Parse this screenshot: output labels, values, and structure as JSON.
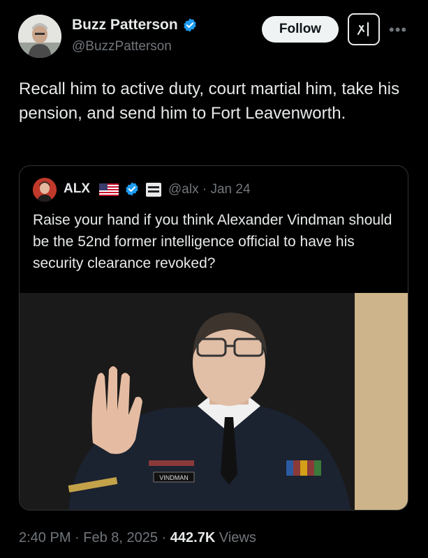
{
  "author": {
    "name": "Buzz Patterson",
    "handle": "@BuzzPatterson",
    "verified": true
  },
  "actions": {
    "follow_label": "Follow",
    "grok_icon": "grok-icon",
    "more_icon": "more-icon"
  },
  "tweet": {
    "text": "Recall him to active duty, court martial him, take his pension, and send him to Fort Leavenworth."
  },
  "quote": {
    "name": "ALX",
    "handle": "@alx",
    "date": "Jan 24",
    "meta": "@alx · Jan 24",
    "text": "Raise your hand if you think Alexander Vindman should be the 52nd former intelligence official to have his security clearance revoked?",
    "image_nameplate": "VINDMAN"
  },
  "footer": {
    "time": "2:40 PM",
    "date": "Feb 8, 2025",
    "views_count": "442.7K",
    "views_label": "Views"
  },
  "colors": {
    "background": "#000000",
    "text": "#e7e9ea",
    "muted": "#71767b",
    "verified": "#1d9bf0",
    "border": "#2f3336"
  }
}
